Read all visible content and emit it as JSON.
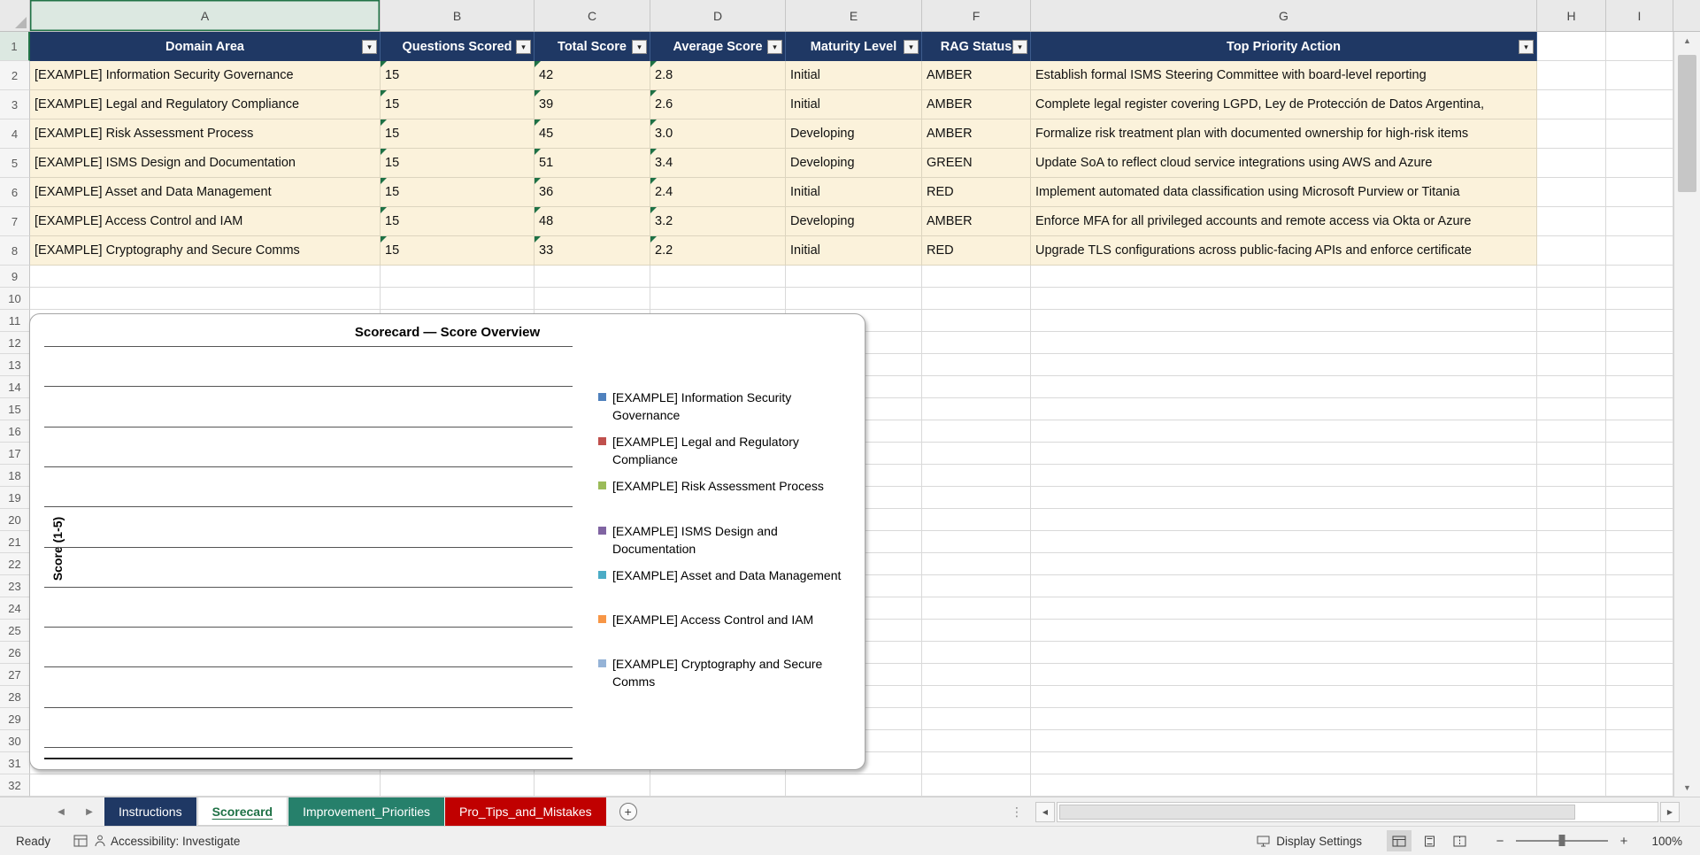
{
  "colors": {
    "table_header_bg": "#1F3864",
    "table_row_bg": "#FBF2DB",
    "excel_green": "#1E7145"
  },
  "grid": {
    "column_letters": [
      "A",
      "B",
      "C",
      "D",
      "E",
      "F",
      "G",
      "H",
      "I"
    ],
    "row_count": 32,
    "selected_column": "A",
    "selected_row": 1
  },
  "table": {
    "headers": [
      "Domain Area",
      "Questions Scored",
      "Total Score",
      "Average Score",
      "Maturity Level",
      "RAG Status",
      "Top Priority Action"
    ],
    "rows": [
      [
        "[EXAMPLE] Information Security Governance",
        "15",
        "42",
        "2.8",
        "Initial",
        "AMBER",
        "Establish formal ISMS Steering Committee with board-level reporting"
      ],
      [
        "[EXAMPLE] Legal and Regulatory Compliance",
        "15",
        "39",
        "2.6",
        "Initial",
        "AMBER",
        "Complete legal register covering LGPD, Ley de Protección de Datos Argentina,"
      ],
      [
        "[EXAMPLE] Risk Assessment Process",
        "15",
        "45",
        "3.0",
        "Developing",
        "AMBER",
        "Formalize risk treatment plan with documented ownership for high-risk items"
      ],
      [
        "[EXAMPLE] ISMS Design and Documentation",
        "15",
        "51",
        "3.4",
        "Developing",
        "GREEN",
        "Update SoA to reflect cloud service integrations using AWS and Azure"
      ],
      [
        "[EXAMPLE] Asset and Data Management",
        "15",
        "36",
        "2.4",
        "Initial",
        "RED",
        "Implement automated data classification using Microsoft Purview or Titania"
      ],
      [
        "[EXAMPLE] Access Control and IAM",
        "15",
        "48",
        "3.2",
        "Developing",
        "AMBER",
        "Enforce MFA for all privileged accounts and remote access via Okta or Azure"
      ],
      [
        "[EXAMPLE] Cryptography and Secure Comms",
        "15",
        "33",
        "2.2",
        "Initial",
        "RED",
        "Upgrade TLS configurations across public-facing APIs and enforce certificate"
      ]
    ]
  },
  "chart": {
    "title": "Scorecard — Score Overview",
    "y_axis_label": "Score (1-5)",
    "gridline_count": 11,
    "legend": [
      {
        "label": "[EXAMPLE] Information Security Governance",
        "color": "#4F81BD"
      },
      {
        "label": "[EXAMPLE] Legal and Regulatory Compliance",
        "color": "#C0504D"
      },
      {
        "label": "[EXAMPLE] Risk Assessment Process",
        "color": "#9BBB59"
      },
      {
        "label": "[EXAMPLE] ISMS Design and Documentation",
        "color": "#8064A2"
      },
      {
        "label": "[EXAMPLE] Asset and Data Management",
        "color": "#4BACC6"
      },
      {
        "label": "[EXAMPLE] Access Control and IAM",
        "color": "#F79646"
      },
      {
        "label": "[EXAMPLE] Cryptography and Secure Comms",
        "color": "#95B3D7"
      }
    ]
  },
  "sheet_tabs": [
    {
      "label": "Instructions",
      "bg": "#1F3864",
      "text_color": "#FFFFFF",
      "active": false
    },
    {
      "label": "Scorecard",
      "bg": "#FFFFFF",
      "text_color": "#1E7145",
      "active": true
    },
    {
      "label": "Improvement_Priorities",
      "bg": "#26806B",
      "text_color": "#FFFFFF",
      "active": false
    },
    {
      "label": "Pro_Tips_and_Mistakes",
      "bg": "#C00000",
      "text_color": "#FFFFFF",
      "active": false
    }
  ],
  "status_bar": {
    "ready_label": "Ready",
    "accessibility_label": "Accessibility: Investigate",
    "display_settings_label": "Display Settings",
    "zoom_label": "100%"
  },
  "icons": {
    "filter_dropdown": "▾",
    "scroll_up": "▲",
    "scroll_down": "▼",
    "scroll_left": "◀",
    "scroll_right": "▶",
    "tab_nav_left": "◀",
    "tab_nav_right": "▶",
    "add_sheet": "+",
    "tab_splitter": "⋮",
    "zoom_out": "−",
    "zoom_in": "+"
  }
}
